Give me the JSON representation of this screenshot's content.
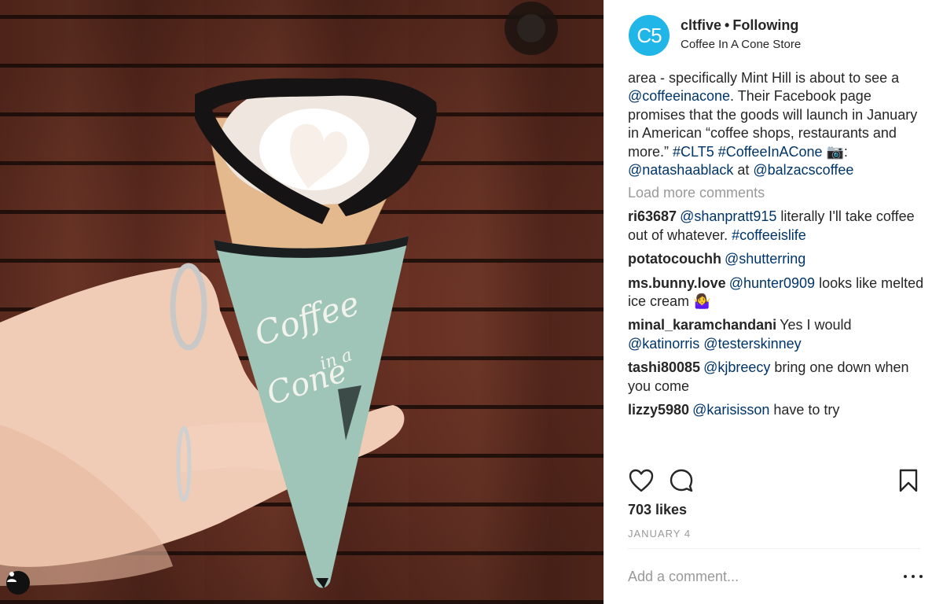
{
  "post": {
    "username": "cltfive",
    "separator": "•",
    "follow_status": "Following",
    "location": "Coffee In A Cone Store",
    "avatar_text": "C5"
  },
  "caption": {
    "parts": [
      {
        "text": "area - specifically Mint Hill is about to see a ",
        "tag": false
      },
      {
        "text": "@coffeeinacone",
        "tag": true
      },
      {
        "text": ". Their Facebook page promises that the goods will launch in January in American “coffee shops, restaurants and more.” ",
        "tag": false
      },
      {
        "text": "#CLT5",
        "tag": true
      },
      {
        "text": " ",
        "tag": false
      },
      {
        "text": "#CoffeeInACone",
        "tag": true
      },
      {
        "text": " 📷: ",
        "tag": false
      },
      {
        "text": "@natashaablack",
        "tag": true
      },
      {
        "text": " at ",
        "tag": false
      },
      {
        "text": "@balzacscoffee",
        "tag": true
      }
    ]
  },
  "load_more_label": "Load more comments",
  "comments": [
    {
      "user": "ri63687",
      "mention": "@shanpratt915",
      "text": " literally I'll take coffee out of whatever. ",
      "hashtag": "#coffeeislife"
    },
    {
      "user": "potatocouchh",
      "mention": "@shutterring",
      "text": "",
      "hashtag": ""
    },
    {
      "user": "ms.bunny.love",
      "mention": "@hunter0909",
      "text": " looks like melted ice cream 🤷‍♀️",
      "hashtag": ""
    },
    {
      "user": "minal_karamchandani",
      "mention": "",
      "text": "Yes I would ",
      "mention2": "@katinorris @testerskinney",
      "hashtag": ""
    },
    {
      "user": "tashi80085",
      "mention": "@kjbreecy",
      "text": " bring one down when you come",
      "hashtag": ""
    },
    {
      "user": "lizzy5980",
      "mention": "@karisisson",
      "text": " have to try",
      "hashtag": ""
    }
  ],
  "likes_label": "703 likes",
  "date_label": "JANUARY 4",
  "add_comment_placeholder": "Add a comment...",
  "icons": {
    "like": "heart-icon",
    "comment": "comment-icon",
    "save": "bookmark-icon",
    "more": "more-options-icon",
    "user_tag": "user-tag-icon"
  },
  "colors": {
    "link": "#003569",
    "muted": "#999999",
    "avatar_bg": "#21b6e8",
    "cone_sleeve": "#9fc4b8"
  },
  "photo": {
    "sleeve_text_line1": "Coffee",
    "sleeve_text_line2": "in a",
    "sleeve_text_line3": "Cone"
  }
}
